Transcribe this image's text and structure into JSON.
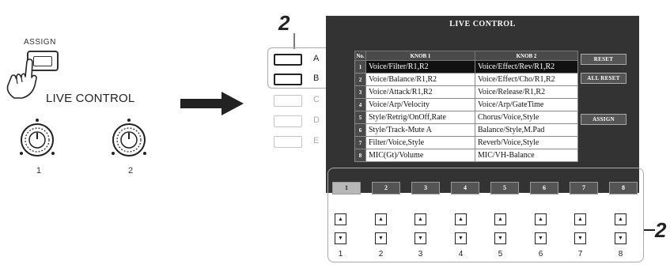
{
  "steps": {
    "top": "2",
    "right": "2"
  },
  "panel": {
    "assign_label": "ASSIGN",
    "live_control_label": "LIVE CONTROL",
    "knob_numbers": [
      "1",
      "2"
    ]
  },
  "banks": [
    {
      "letter": "A",
      "active": true
    },
    {
      "letter": "B",
      "active": true
    },
    {
      "letter": "C",
      "active": false
    },
    {
      "letter": "D",
      "active": false
    },
    {
      "letter": "E",
      "active": false
    }
  ],
  "screen": {
    "title": "LIVE CONTROL",
    "headers": {
      "no": "No.",
      "knob1": "KNOB 1",
      "knob2": "KNOB 2"
    },
    "rows": [
      {
        "no": "1",
        "knob1": "Voice/Filter/R1,R2",
        "knob2": "Voice/Effect/Rev/R1,R2",
        "selected": true
      },
      {
        "no": "2",
        "knob1": "Voice/Balance/R1,R2",
        "knob2": "Voice/Effect/Cho/R1,R2",
        "selected": false
      },
      {
        "no": "3",
        "knob1": "Voice/Attack/R1,R2",
        "knob2": "Voice/Release/R1,R2",
        "selected": false
      },
      {
        "no": "4",
        "knob1": "Voice/Arp/Velocity",
        "knob2": "Voice/Arp/GateTime",
        "selected": false
      },
      {
        "no": "5",
        "knob1": "Style/Retrig/OnOff,Rate",
        "knob2": "Chorus/Voice,Style",
        "selected": false
      },
      {
        "no": "6",
        "knob1": "Style/Track-Mute A",
        "knob2": "Balance/Style,M.Pad",
        "selected": false
      },
      {
        "no": "7",
        "knob1": "Filter/Voice,Style",
        "knob2": "Reverb/Voice,Style",
        "selected": false
      },
      {
        "no": "8",
        "knob1": "MIC(Gt)/Volume",
        "knob2": "MIC/VH-Balance",
        "selected": false
      }
    ],
    "buttons": {
      "reset": "RESET",
      "all_reset": "ALL RESET",
      "assign": "ASSIGN"
    },
    "tabs": [
      "1",
      "2",
      "3",
      "4",
      "5",
      "6",
      "7",
      "8"
    ],
    "active_tab": "1"
  },
  "physical_buttons": [
    "1",
    "2",
    "3",
    "4",
    "5",
    "6",
    "7",
    "8"
  ],
  "colors": {
    "screen_bg": "#333333",
    "selected_row": "#111111",
    "header_bg": "#4a4a4a"
  },
  "icons": {
    "up": "triangle-up-icon",
    "down": "triangle-down-icon"
  }
}
